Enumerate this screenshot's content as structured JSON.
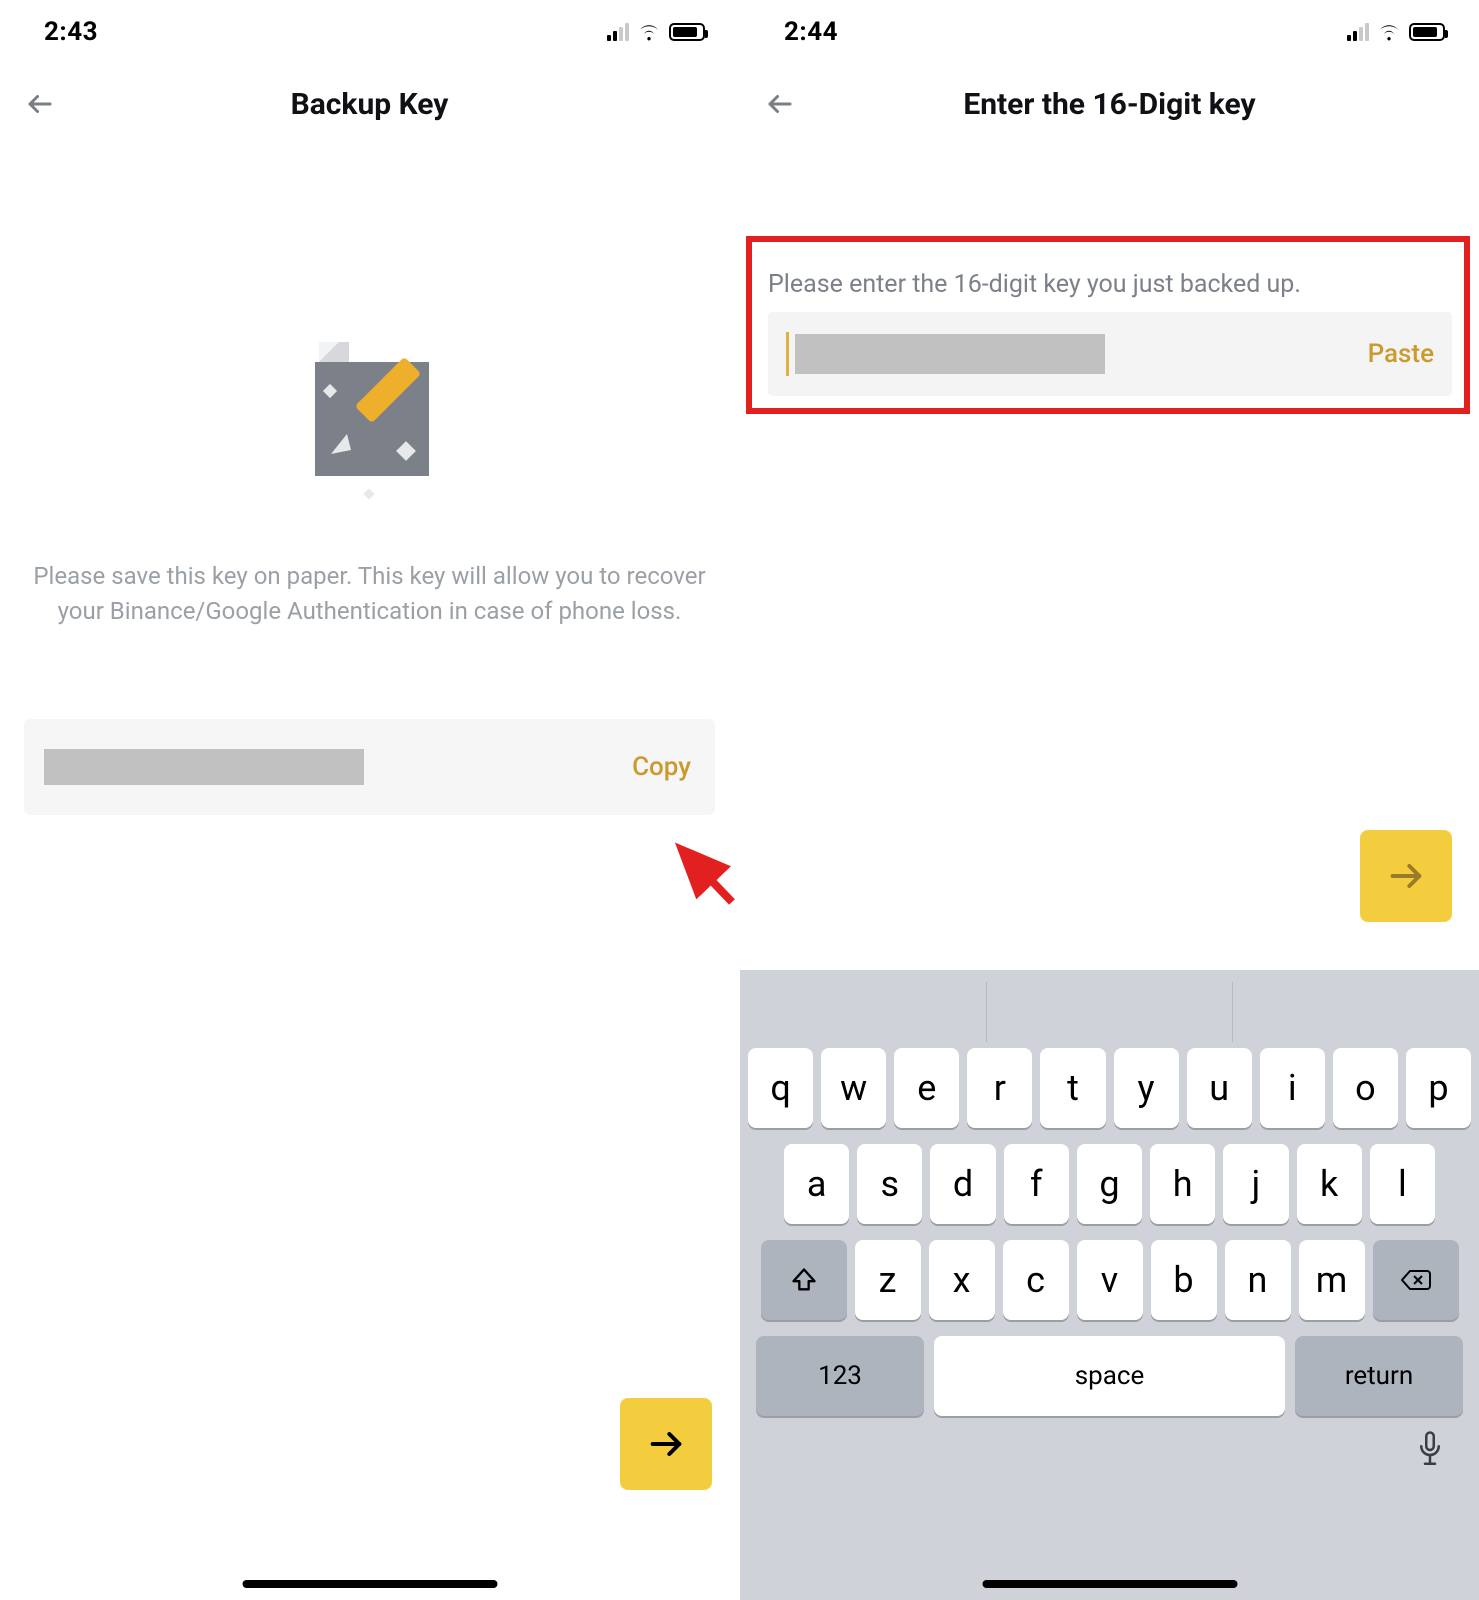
{
  "left": {
    "status_time": "2:43",
    "title": "Backup Key",
    "description": "Please save this key on paper. This key will allow you to recover your Binance/Google Authentication in case of phone loss.",
    "copy_label": "Copy"
  },
  "right": {
    "status_time": "2:44",
    "title": "Enter the 16-Digit key",
    "prompt": "Please enter the 16-digit key you just backed up.",
    "paste_label": "Paste"
  },
  "keyboard": {
    "row1": [
      "q",
      "w",
      "e",
      "r",
      "t",
      "y",
      "u",
      "i",
      "o",
      "p"
    ],
    "row2": [
      "a",
      "s",
      "d",
      "f",
      "g",
      "h",
      "j",
      "k",
      "l"
    ],
    "row3": [
      "z",
      "x",
      "c",
      "v",
      "b",
      "n",
      "m"
    ],
    "num_label": "123",
    "space_label": "space",
    "return_label": "return"
  }
}
